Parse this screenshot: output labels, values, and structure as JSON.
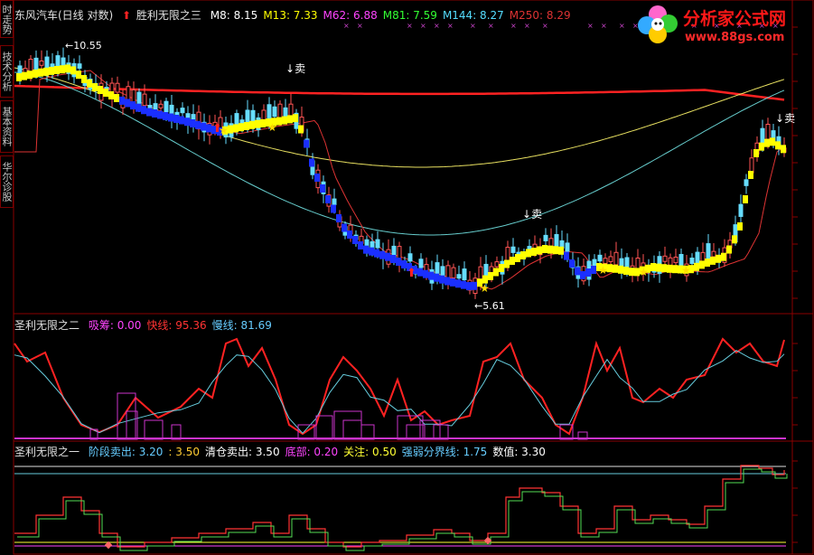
{
  "header": {
    "stock_name": "东风汽车(日线 对数)",
    "indicator_name": "胜利无限之三",
    "ma": [
      {
        "label": "M8",
        "value": "8.15",
        "color": "#ffffff"
      },
      {
        "label": "M13",
        "value": "7.33",
        "color": "#ffff00"
      },
      {
        "label": "M62",
        "value": "6.88",
        "color": "#ff44ff"
      },
      {
        "label": "M81",
        "value": "7.59",
        "color": "#33ff33"
      },
      {
        "label": "M144",
        "value": "8.27",
        "color": "#55ddff"
      },
      {
        "label": "M250",
        "value": "8.29",
        "color": "#dd3333"
      }
    ]
  },
  "sidebar": {
    "tabs": [
      "时走势",
      "技术分析",
      "基本资料",
      "华尔诊股"
    ]
  },
  "logo": {
    "title": "分析家公式网",
    "url": "www.88gs.com"
  },
  "main_chart": {
    "annotations": {
      "high": "10.55",
      "low": "5.61",
      "sell_label": "卖"
    }
  },
  "panel2": {
    "title": "圣利无限之二",
    "items": [
      {
        "label": "吸筹",
        "value": "0.00",
        "color": "#ff44ff"
      },
      {
        "label": "快线",
        "value": "95.36",
        "color": "#ff3333"
      },
      {
        "label": "慢线",
        "value": "81.69",
        "color": "#66ccff"
      }
    ]
  },
  "panel3": {
    "title": "圣利无限之一",
    "items": [
      {
        "label": "阶段卖出",
        "value": "3.20",
        "color": "#66ccff"
      },
      {
        "label": "",
        "value": "3.50",
        "color": "#ffcc33"
      },
      {
        "label": "清仓卖出",
        "value": "3.50",
        "color": "#ffffff"
      },
      {
        "label": "底部",
        "value": "0.20",
        "color": "#ff44ff"
      },
      {
        "label": "关注",
        "value": "0.50",
        "color": "#ffff33"
      },
      {
        "label": "强弱分界线",
        "value": "1.75",
        "color": "#66ccff"
      },
      {
        "label": "数值",
        "value": "3.30",
        "color": "#ffffff"
      }
    ]
  }
}
